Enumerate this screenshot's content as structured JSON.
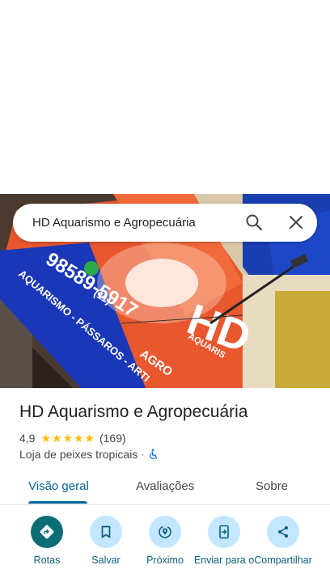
{
  "search": {
    "query": "HD Aquarismo e Agropecuária"
  },
  "photo": {
    "sign_phone_area": "(11)",
    "sign_phone_number": "98589-5917",
    "sign_subtitle": "AQUARISMO - PÁSSAROS - ARTI",
    "sign_logo": "HD",
    "sign_logo_sub1": "AQUARIS",
    "sign_logo_sub2": "AGRO"
  },
  "place": {
    "name": "HD Aquarismo e Agropecuária",
    "rating": "4,9",
    "stars": 5,
    "review_count": "(169)",
    "category": "Loja de peixes tropicais",
    "separator": "·"
  },
  "tabs": [
    {
      "label": "Visão geral",
      "active": true
    },
    {
      "label": "Avaliações",
      "active": false
    },
    {
      "label": "Sobre",
      "active": false
    }
  ],
  "actions": [
    {
      "label": "Rotas",
      "icon": "directions-icon"
    },
    {
      "label": "Salvar",
      "icon": "bookmark-icon"
    },
    {
      "label": "Próximo",
      "icon": "nearby-icon"
    },
    {
      "label": "Enviar para o",
      "icon": "send-to-phone-icon"
    },
    {
      "label": "Compartilhar",
      "icon": "share-icon"
    }
  ],
  "colors": {
    "accent": "#00639b",
    "primary_action": "#0b6e74",
    "action_bg": "#c2e7ff",
    "star": "#fbbc04"
  }
}
